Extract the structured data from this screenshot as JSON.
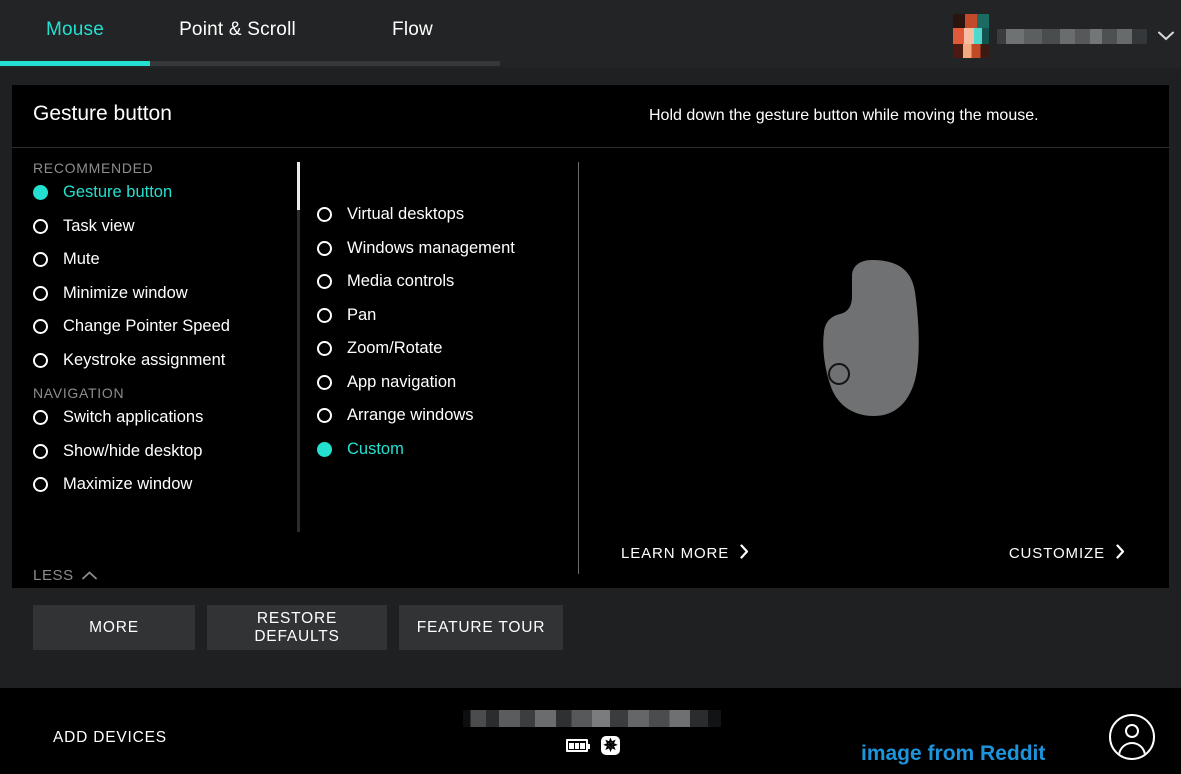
{
  "topbar": {
    "tabs": [
      {
        "label": "Mouse",
        "active": true
      },
      {
        "label": "Point & Scroll",
        "active": false
      },
      {
        "label": "Flow",
        "active": false
      }
    ],
    "accent_color": "#24e0d0",
    "account": {
      "name_redacted": "",
      "chevron_icon": "chevron-down-icon"
    }
  },
  "panel": {
    "title": "Gesture button",
    "hint": "Hold down the gesture button while moving the mouse.",
    "sidebar": {
      "groups": [
        {
          "label": "RECOMMENDED",
          "items": [
            {
              "label": "Gesture button",
              "selected": true
            },
            {
              "label": "Task view",
              "selected": false
            },
            {
              "label": "Mute",
              "selected": false
            },
            {
              "label": "Minimize window",
              "selected": false
            },
            {
              "label": "Change Pointer Speed",
              "selected": false
            },
            {
              "label": "Keystroke assignment",
              "selected": false
            }
          ]
        },
        {
          "label": "NAVIGATION",
          "items": [
            {
              "label": "Switch applications",
              "selected": false
            },
            {
              "label": "Show/hide desktop",
              "selected": false
            },
            {
              "label": "Maximize window",
              "selected": false
            }
          ]
        }
      ],
      "collapse_label": "LESS",
      "collapse_icon": "chevron-up-icon"
    },
    "options": [
      {
        "label": "Virtual desktops",
        "selected": false
      },
      {
        "label": "Windows management",
        "selected": false
      },
      {
        "label": "Media controls",
        "selected": false
      },
      {
        "label": "Pan",
        "selected": false
      },
      {
        "label": "Zoom/Rotate",
        "selected": false
      },
      {
        "label": "App navigation",
        "selected": false
      },
      {
        "label": "Arrange windows",
        "selected": false
      },
      {
        "label": "Custom",
        "selected": true
      }
    ],
    "preview": {
      "device_art": "mouse-silhouette",
      "marker": "gesture-button-marker",
      "links": [
        {
          "label": "LEARN MORE",
          "icon": "chevron-right-icon"
        },
        {
          "label": "CUSTOMIZE",
          "icon": "chevron-right-icon"
        }
      ]
    }
  },
  "buttons": {
    "more": "MORE",
    "restore_defaults": "RESTORE DEFAULTS",
    "feature_tour": "FEATURE TOUR"
  },
  "footer": {
    "add_devices": "ADD DEVICES",
    "device_name_redacted": "",
    "battery_icon": "battery-icon",
    "connection_icon": "bolt-icon",
    "watermark": "image from Reddit",
    "watermark_color": "#1c95dd",
    "avatar_icon": "account-avatar-icon"
  }
}
